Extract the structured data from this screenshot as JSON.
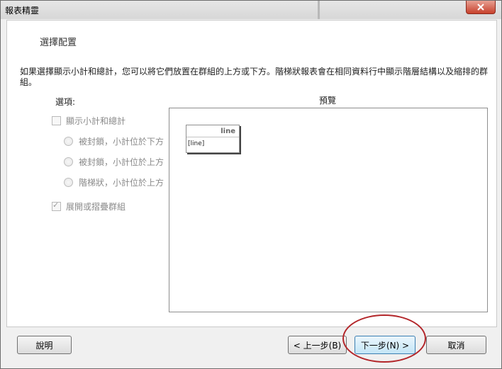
{
  "window": {
    "title": "報表精靈"
  },
  "page": {
    "heading": "選擇配置",
    "description": "如果選擇顯示小計和總計，您可以將它們放置在群組的上方或下方。階梯狀報表會在相同資料行中顯示階層結構以及縮排的群組。"
  },
  "options": {
    "label": "選項:",
    "show_subtotals": {
      "label": "顯示小計和總計",
      "checked": false,
      "enabled": false
    },
    "radios": [
      {
        "label": "被封鎖，小計位於下方",
        "selected": false,
        "enabled": false
      },
      {
        "label": "被封鎖，小計位於上方",
        "selected": false,
        "enabled": false
      },
      {
        "label": "階梯狀，小計位於上方",
        "selected": false,
        "enabled": false
      }
    ],
    "expand_collapse": {
      "label": "展開或摺疊群組",
      "checked": true,
      "enabled": false
    }
  },
  "preview": {
    "label": "預覽",
    "table_header": "line",
    "table_cell": "[line]"
  },
  "buttons": {
    "help": "說明",
    "back": "< 上一步(B)",
    "next": "下一步(N) >",
    "cancel": "取消"
  },
  "colors": {
    "annotation": "#b3262a",
    "close_button": "#c7412c"
  }
}
